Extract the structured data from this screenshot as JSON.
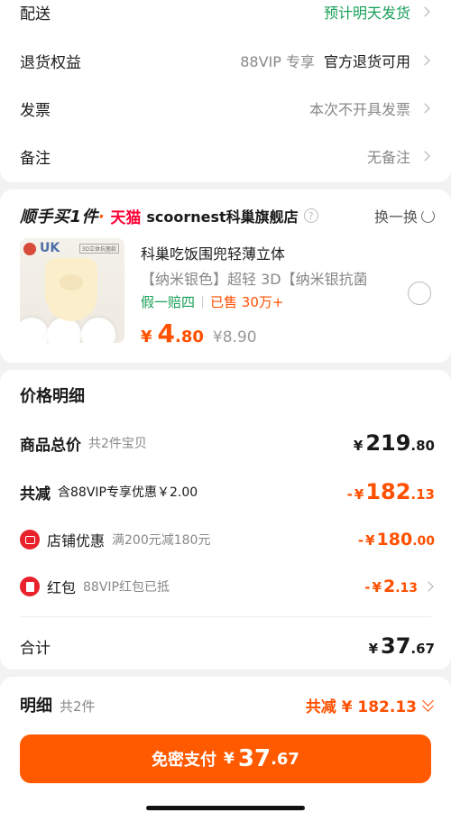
{
  "delivery": {
    "label": "配送",
    "value": "预计明天发货"
  },
  "return_rights": {
    "label": "退货权益",
    "vip": "88VIP 专享",
    "value": "官方退货可用"
  },
  "invoice": {
    "label": "发票",
    "value": "本次不开具发票"
  },
  "note": {
    "label": "备注",
    "value": "无备注"
  },
  "shop": {
    "easy_buy": "顺手买1件",
    "tmall": "天猫",
    "name": "scoornest科巢旗舰店",
    "help": "?",
    "swap_label": "换一换"
  },
  "product": {
    "thumb_brand": "UK",
    "thumb_tag": "3D立体抗菌款",
    "title": "科巢吃饭围兜轻薄立体",
    "spec": "【纳米银色】超轻 3D【纳米银抗菌",
    "guarantee": "假一赔四",
    "sold": "已售 30万+",
    "price_currency": "¥",
    "price_int": "4",
    "price_dec": ".80",
    "orig_price": "¥8.90"
  },
  "price_detail": {
    "title": "价格明细",
    "goods_total": {
      "label": "商品总价",
      "sub": "共2件宝贝",
      "currency": "¥",
      "int": "219",
      "dec": ".80"
    },
    "total_reduce": {
      "label": "共减",
      "sub": "含88VIP专享优惠￥2.00",
      "prefix": "-",
      "currency": "¥",
      "int": "182",
      "dec": ".13"
    },
    "shop_coupon": {
      "label": "店铺优惠",
      "sub": "满200元减180元",
      "prefix": "-",
      "currency": "¥",
      "int": "180",
      "dec": ".00"
    },
    "red_packet": {
      "label": "红包",
      "sub": "88VIP红包已抵",
      "prefix": "-",
      "currency": "¥",
      "int": "2",
      "dec": ".13"
    },
    "sum": {
      "label": "合计",
      "currency": "¥",
      "int": "37",
      "dec": ".67"
    }
  },
  "detail_bar": {
    "label": "明细",
    "count": "共2件",
    "reduce": "共减 ¥ 182.13"
  },
  "pay_button": {
    "label": "免密支付",
    "currency": "¥",
    "int": "37",
    "dec": ".67"
  },
  "colors": {
    "accent": "#ff5000",
    "green": "#18a058",
    "tmall_red": "#ff0036",
    "button": "#ff5a00"
  }
}
